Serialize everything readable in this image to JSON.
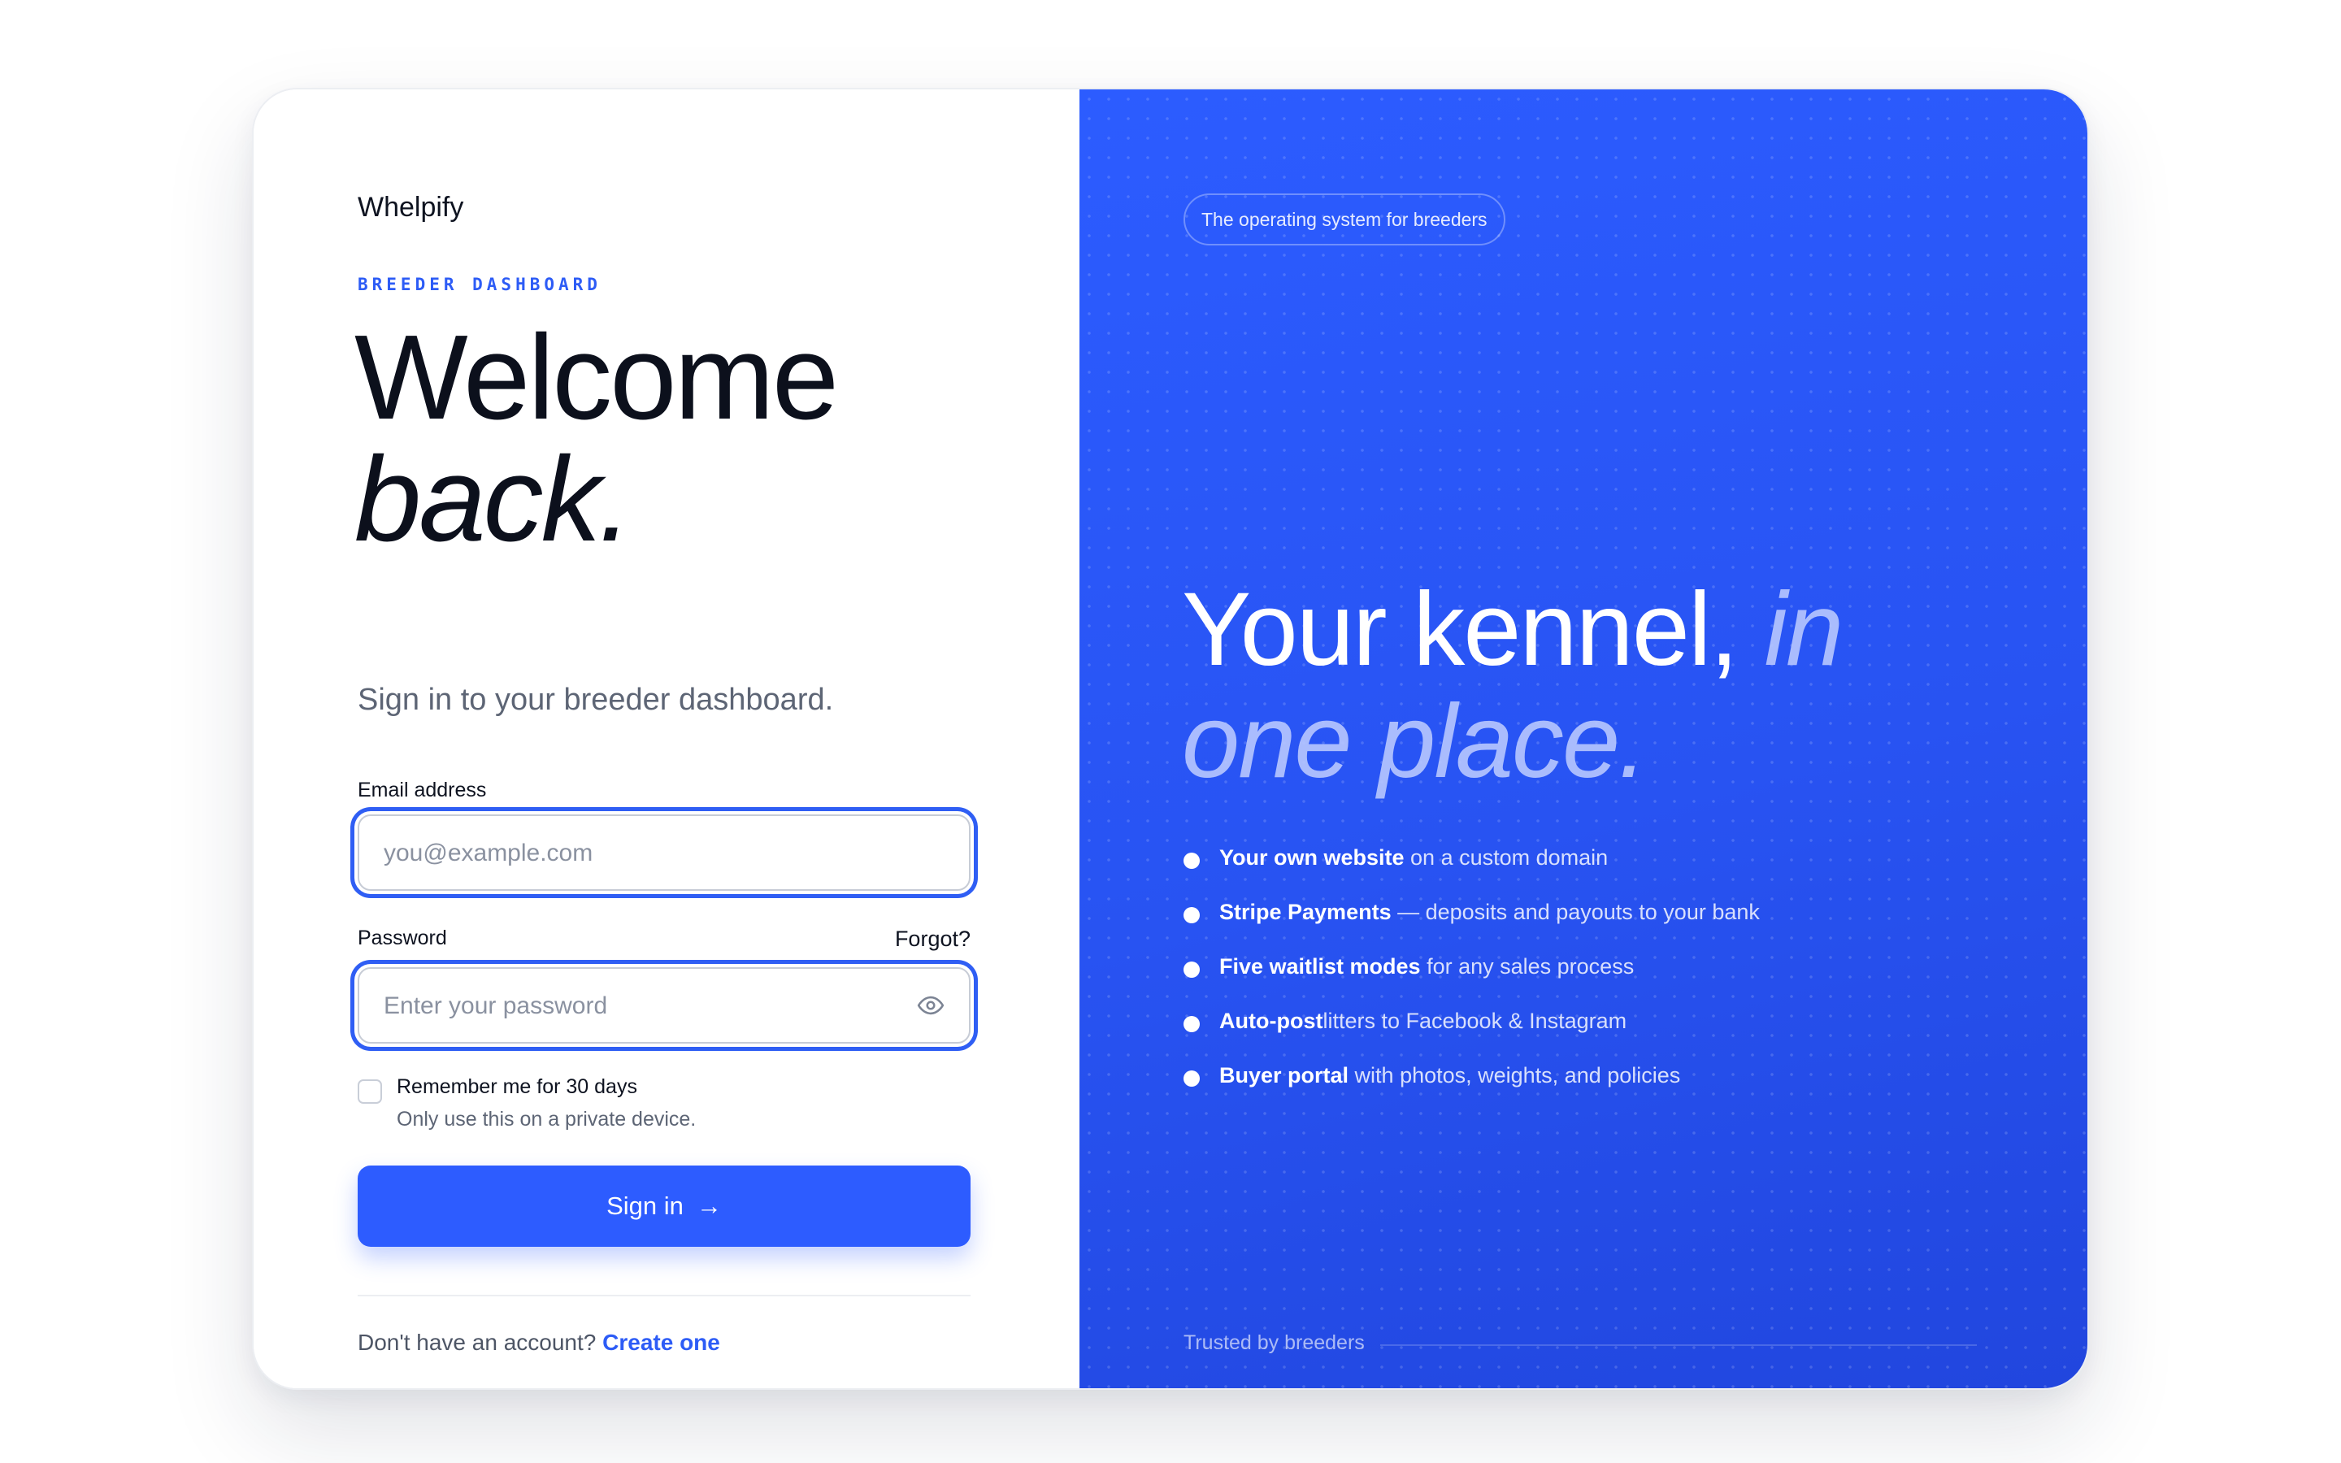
{
  "brand": {
    "name": "Whelpify"
  },
  "signin": {
    "eyebrow": "BREEDER DASHBOARD",
    "title_line1": "Welcome",
    "title_line2": "back.",
    "subtitle": "Sign in to your breeder dashboard.",
    "email": {
      "label": "Email address",
      "value": "",
      "placeholder": "you@example.com"
    },
    "password": {
      "label": "Password",
      "forgot": "Forgot?",
      "value": "",
      "placeholder": "Enter your password",
      "icon": "eye-icon"
    },
    "remember": {
      "label": "Remember me for 30 days",
      "note": "Only use this on a private device.",
      "checked": false
    },
    "submit": {
      "label": "Sign in",
      "arrow": "→"
    },
    "footer": {
      "prompt": "Don't have an account?",
      "link": "Create one"
    }
  },
  "promo": {
    "tag": "The operating system for breeders",
    "headline_main": "Your kennel,",
    "headline_accent_1": "in",
    "headline_accent_2": "one place.",
    "features": [
      {
        "bold": "Your own website",
        "rest": " on a custom domain"
      },
      {
        "bold": "Stripe Payments",
        "rest": " — deposits and payouts to your bank"
      },
      {
        "bold": "Five waitlist modes",
        "rest": " for any sales process"
      },
      {
        "bold": "Auto-post",
        "rest": "litters to Facebook & Instagram"
      },
      {
        "bold": "Buyer portal",
        "rest": " with photos, weights, and policies"
      }
    ],
    "trusted": "Trusted by breeders"
  },
  "colors": {
    "accent": "#2d5cff",
    "panel": "#2853f2",
    "text": "#0e1320",
    "muted": "#5d6575"
  }
}
